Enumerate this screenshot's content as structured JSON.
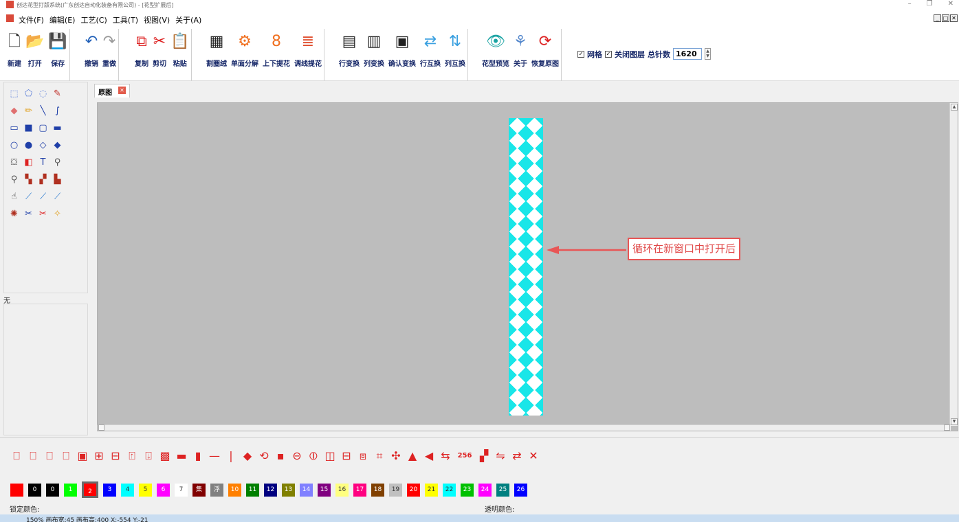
{
  "window": {
    "title": "创达花型打版系统(广东创达自动化装备有限公司) - [花型扩展后]",
    "controls": [
      "–",
      "❐",
      "✕"
    ],
    "mdi_controls": [
      "_",
      "□",
      "✕"
    ]
  },
  "menus": [
    "文件(F)",
    "编辑(E)",
    "工艺(C)",
    "工具(T)",
    "视图(V)",
    "关于(A)"
  ],
  "toolbar": {
    "groups": [
      [
        {
          "label": "新建",
          "icon": "new-file-icon",
          "glyph": "🗋",
          "color": "#222"
        },
        {
          "label": "打开",
          "icon": "open-folder-icon",
          "glyph": "📂",
          "color": "#e0a020"
        },
        {
          "label": "保存",
          "icon": "save-icon",
          "glyph": "💾",
          "color": "#2a5ca8"
        }
      ],
      [
        {
          "label": "撤销",
          "icon": "undo-icon",
          "glyph": "↶",
          "color": "#1f5fb8"
        },
        {
          "label": "重做",
          "icon": "redo-icon",
          "glyph": "↷",
          "color": "#999"
        }
      ],
      [
        {
          "label": "复制",
          "icon": "copy-icon",
          "glyph": "⧉",
          "color": "#d22"
        },
        {
          "label": "剪切",
          "icon": "cut-icon",
          "glyph": "✂",
          "color": "#d22"
        },
        {
          "label": "粘贴",
          "icon": "paste-icon",
          "glyph": "📋",
          "color": "#d22"
        }
      ],
      [
        {
          "label": "割圈绒",
          "icon": "cut-pile-icon",
          "glyph": "▦",
          "color": "#222"
        },
        {
          "label": "单面分解",
          "icon": "gear-icon",
          "glyph": "⚙",
          "color": "#f07020"
        },
        {
          "label": "上下提花",
          "icon": "jacquard-updown-icon",
          "glyph": "8",
          "color": "#f07020"
        },
        {
          "label": "调线提花",
          "icon": "jacquard-thread-icon",
          "glyph": "≣",
          "color": "#e05030"
        }
      ],
      [
        {
          "label": "行变换",
          "icon": "row-transform-icon",
          "glyph": "▤",
          "color": "#222"
        },
        {
          "label": "列变换",
          "icon": "column-transform-icon",
          "glyph": "▥",
          "color": "#222"
        },
        {
          "label": "确认变换",
          "icon": "confirm-transform-icon",
          "glyph": "▣",
          "color": "#222"
        },
        {
          "label": "行互换",
          "icon": "row-swap-icon",
          "glyph": "⇄",
          "color": "#3aa0e0"
        },
        {
          "label": "列互换",
          "icon": "column-swap-icon",
          "glyph": "⇅",
          "color": "#3aa0e0"
        }
      ],
      [
        {
          "label": "花型预览",
          "icon": "eye-icon",
          "glyph": "👁",
          "color": "#1aa3a3"
        },
        {
          "label": "关于",
          "icon": "about-icon",
          "glyph": "⚘",
          "color": "#5588cc"
        },
        {
          "label": "恢复原图",
          "icon": "restore-icon",
          "glyph": "⟳",
          "color": "#d22"
        }
      ]
    ],
    "options": {
      "grid_label": "网格",
      "grid_checked": true,
      "close_layer_label": "关闭图层",
      "close_layer_checked": true,
      "total_stitches_label": "总针数",
      "total_stitches_value": "1620"
    }
  },
  "tools": [
    [
      {
        "icon": "rect-select-icon",
        "glyph": "⬚",
        "color": "#5c7fd8"
      },
      {
        "icon": "polygon-select-icon",
        "glyph": "⬠",
        "color": "#5c7fd8"
      },
      {
        "icon": "lasso-icon",
        "glyph": "◌",
        "color": "#5c7fd8"
      },
      {
        "icon": "eyedropper-icon",
        "glyph": "✎",
        "color": "#c0302a"
      }
    ],
    [
      {
        "icon": "eraser-icon",
        "glyph": "◆",
        "color": "#e07070"
      },
      {
        "icon": "pencil-icon",
        "glyph": "✏",
        "color": "#e0a020"
      },
      {
        "icon": "line-icon",
        "glyph": "╲",
        "color": "#1f3fa8"
      },
      {
        "icon": "curve-icon",
        "glyph": "∫",
        "color": "#1f3fa8"
      }
    ],
    [
      {
        "icon": "rectangle-icon",
        "glyph": "▭",
        "color": "#1f3fa8"
      },
      {
        "icon": "filled-rectangle-icon",
        "glyph": "■",
        "color": "#1f3fa8"
      },
      {
        "icon": "rounded-rect-icon",
        "glyph": "▢",
        "color": "#1f3fa8"
      },
      {
        "icon": "filled-rounded-rect-icon",
        "glyph": "▬",
        "color": "#1f3fa8"
      }
    ],
    [
      {
        "icon": "ellipse-icon",
        "glyph": "○",
        "color": "#1f3fa8"
      },
      {
        "icon": "filled-ellipse-icon",
        "glyph": "●",
        "color": "#1f3fa8"
      },
      {
        "icon": "diamond-icon",
        "glyph": "◇",
        "color": "#1f3fa8"
      },
      {
        "icon": "filled-diamond-icon",
        "glyph": "◆",
        "color": "#1f3fa8"
      }
    ],
    [
      {
        "icon": "fill-bucket-icon",
        "glyph": "⛋",
        "color": "#555"
      },
      {
        "icon": "color-replace-icon",
        "glyph": "◧",
        "color": "#d22"
      },
      {
        "icon": "text-icon",
        "glyph": "T",
        "color": "#1f3fa8"
      },
      {
        "icon": "zoom-in-icon",
        "glyph": "⚲",
        "color": "#555"
      }
    ],
    [
      {
        "icon": "zoom-out-icon",
        "glyph": "⚲",
        "color": "#555"
      },
      {
        "icon": "pattern-stamp-icon",
        "glyph": "▚",
        "color": "#b03020"
      },
      {
        "icon": "pattern-repeat-icon",
        "glyph": "▞",
        "color": "#b03020"
      },
      {
        "icon": "pattern-mirror-icon",
        "glyph": "▙",
        "color": "#b03020"
      }
    ],
    [
      {
        "icon": "hand-icon",
        "glyph": "☝",
        "color": "#333"
      },
      {
        "icon": "measure-icon",
        "glyph": "⟋",
        "color": "#2a7ad0"
      },
      {
        "icon": "measure-point-icon",
        "glyph": "⟋",
        "color": "#2a7ad0"
      },
      {
        "icon": "measure-angle-icon",
        "glyph": "⟋",
        "color": "#2a7ad0"
      }
    ],
    [
      {
        "icon": "color-wheel-icon",
        "glyph": "✺",
        "color": "#b03020"
      },
      {
        "icon": "scissors-icon",
        "glyph": "✂",
        "color": "#1f3fa8"
      },
      {
        "icon": "scissors-multi-icon",
        "glyph": "✂",
        "color": "#d22"
      },
      {
        "icon": "magic-wand-icon",
        "glyph": "✧",
        "color": "#e0a020"
      }
    ]
  ],
  "layer_label": "无",
  "document": {
    "tab_label": "原图",
    "annotation": "循环在新窗口中打开后"
  },
  "shape_tools": [
    {
      "icon": "frame-left-icon",
      "glyph": "⎕"
    },
    {
      "icon": "frame-both-icon",
      "glyph": "⎕"
    },
    {
      "icon": "frame-top-icon",
      "glyph": "⎕"
    },
    {
      "icon": "frame-bottom-icon",
      "glyph": "⎕"
    },
    {
      "icon": "frame-all-icon",
      "glyph": "▣"
    },
    {
      "icon": "insert-column-icon",
      "glyph": "⊞"
    },
    {
      "icon": "delete-column-icon",
      "glyph": "⊟"
    },
    {
      "icon": "insert-row-icon",
      "glyph": "⍐"
    },
    {
      "icon": "delete-row-icon",
      "glyph": "⍗"
    },
    {
      "icon": "checker-icon",
      "glyph": "▩"
    },
    {
      "icon": "horizontal-bar-icon",
      "glyph": "▬"
    },
    {
      "icon": "vertical-bar-icon",
      "glyph": "▮"
    },
    {
      "icon": "horizontal-line-icon",
      "glyph": "—"
    },
    {
      "icon": "vertical-line-icon",
      "glyph": "|"
    },
    {
      "icon": "point-icon",
      "glyph": "◆"
    },
    {
      "icon": "rotate-icon",
      "glyph": "⟲"
    },
    {
      "icon": "block-icon",
      "glyph": "▪"
    },
    {
      "icon": "flip-vertical-icon",
      "glyph": "⊖"
    },
    {
      "icon": "flip-horizontal-icon",
      "glyph": "⦶"
    },
    {
      "icon": "split-vertical-icon",
      "glyph": "◫"
    },
    {
      "icon": "split-horizontal-icon",
      "glyph": "⊟"
    },
    {
      "icon": "center-icon",
      "glyph": "⧈"
    },
    {
      "icon": "crop-icon",
      "glyph": "⌗"
    },
    {
      "icon": "move-icon",
      "glyph": "✣"
    },
    {
      "icon": "mirror-icon",
      "glyph": "▲"
    },
    {
      "icon": "arrow-left-icon",
      "glyph": "◀"
    },
    {
      "icon": "shift-icon",
      "glyph": "⇆"
    },
    {
      "icon": "colors-256-icon",
      "text": "256"
    },
    {
      "icon": "palette-icon",
      "glyph": "▞"
    },
    {
      "icon": "color-swap-icon",
      "glyph": "⇋"
    },
    {
      "icon": "transfer-icon",
      "glyph": "⇄"
    },
    {
      "icon": "delete-icon",
      "glyph": "✕"
    }
  ],
  "palette": [
    {
      "label": "",
      "color": "#ff0000"
    },
    {
      "label": "0",
      "color": "#000000"
    },
    {
      "label": "0",
      "color": "#000000"
    },
    {
      "label": "1",
      "color": "#00ff00"
    },
    {
      "label": "2",
      "color": "#ff0000",
      "selected": true
    },
    {
      "label": "3",
      "color": "#0000ff"
    },
    {
      "label": "4",
      "color": "#00ffff"
    },
    {
      "label": "5",
      "color": "#ffff00"
    },
    {
      "label": "6",
      "color": "#ff00ff"
    },
    {
      "label": "7",
      "color": "#ffffff"
    },
    {
      "label": "集",
      "color": "#800000"
    },
    {
      "label": "浮",
      "color": "#808080"
    },
    {
      "label": "10",
      "color": "#ff8000"
    },
    {
      "label": "11",
      "color": "#008000"
    },
    {
      "label": "12",
      "color": "#000080"
    },
    {
      "label": "13",
      "color": "#808000"
    },
    {
      "label": "14",
      "color": "#8080ff"
    },
    {
      "label": "15",
      "color": "#800080"
    },
    {
      "label": "16",
      "color": "#ffff80"
    },
    {
      "label": "17",
      "color": "#ff0080"
    },
    {
      "label": "18",
      "color": "#804000"
    },
    {
      "label": "19",
      "color": "#c0c0c0"
    },
    {
      "label": "20",
      "color": "#ff0000"
    },
    {
      "label": "21",
      "color": "#ffff00"
    },
    {
      "label": "22",
      "color": "#00ffff"
    },
    {
      "label": "23",
      "color": "#00c000"
    },
    {
      "label": "24",
      "color": "#ff00ff"
    },
    {
      "label": "25",
      "color": "#008080"
    },
    {
      "label": "26",
      "color": "#0000ff"
    }
  ],
  "locked_color_label": "锁定颜色:",
  "transparent_color_label": "透明颜色:",
  "status": "150%  画布宽:45  画布高:400    X:-554 Y:-21"
}
